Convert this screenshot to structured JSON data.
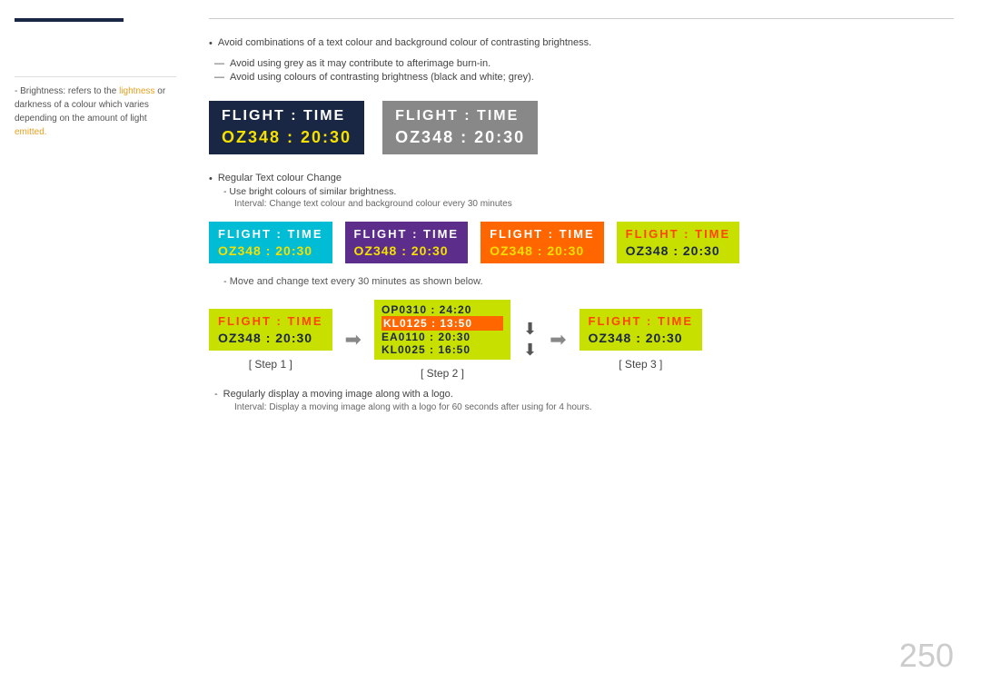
{
  "sidebar": {
    "note_prefix": "- Brightness: refers to the lightness",
    "note_line2": "or darkness of a colour which varies",
    "note_line3": "depending on the amount of light",
    "note_line4_highlight": "emitted."
  },
  "main": {
    "bullet1": "Avoid combinations of a text colour and background colour of contrasting brightness.",
    "dash1": "Avoid using grey as it may contribute to afterimage burn-in.",
    "dash2": "Avoid using colours of contrasting brightness (black and white; grey).",
    "flight_dark": {
      "label": "FLIGHT  :  TIME",
      "value": "OZ348  :  20:30"
    },
    "flight_gray": {
      "label": "FLIGHT  :  TIME",
      "value": "OZ348  :  20:30"
    },
    "section_title": "Regular Text colour Change",
    "sub1": "Use bright colours of similar brightness.",
    "sub2": "Interval: Change text colour and background colour every 30 minutes",
    "color_variants": [
      {
        "id": "cyan",
        "label": "FLIGHT  :  TIME",
        "value": "OZ348  :  20:30"
      },
      {
        "id": "purple",
        "label": "FLIGHT  :  TIME",
        "value": "OZ348  :  20:30"
      },
      {
        "id": "orange",
        "label": "FLIGHT  :  TIME",
        "value": "OZ348  :  20:30"
      },
      {
        "id": "yellow",
        "label": "FLIGHT  :  TIME",
        "value": "OZ348  :  20:30"
      }
    ],
    "step_note": "Move and change text every 30 minutes as shown below.",
    "step1": {
      "label": "[ Step 1 ]",
      "box_label": "FLIGHT  :  TIME",
      "box_value": "OZ348  :  20:30"
    },
    "step2": {
      "label": "[ Step 2 ]",
      "rows": [
        {
          "text": "OP0310  :  24:20",
          "highlight": false
        },
        {
          "text": "KL0125  :  13:50",
          "highlight": true
        },
        {
          "text": "EA0110  :  20:30",
          "highlight": false
        },
        {
          "text": "KL0025  :  16:50",
          "highlight": false
        }
      ]
    },
    "step3": {
      "label": "[ Step 3 ]",
      "box_label": "FLIGHT  :  TIME",
      "box_value": "OZ348  :  20:30"
    },
    "footer_note1": "Regularly display a moving image along with a logo.",
    "footer_note2": "Interval: Display a moving image along with a logo for 60 seconds after using for 4 hours.",
    "page_number": "250"
  }
}
